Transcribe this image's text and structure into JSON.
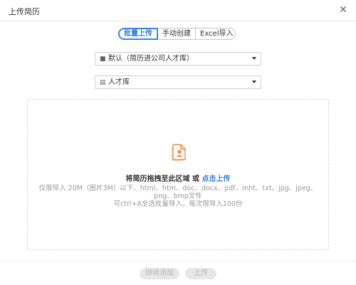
{
  "window": {
    "title": "上传简历",
    "close_glyph": "✕"
  },
  "tabs": [
    {
      "label": "批量上传",
      "active": true
    },
    {
      "label": "手动创建",
      "active": false
    },
    {
      "label": "Excel导入",
      "active": false
    }
  ],
  "selects": {
    "folder": {
      "icon": "folder-icon",
      "value": "默认（简历进公司人才库）"
    },
    "library": {
      "icon": "database-icon",
      "value": "人才库"
    }
  },
  "dropzone": {
    "main_text": "将简历拖拽至此区域 或 ",
    "link_text": "点击上传",
    "hint_line1": "仅限导入 20M（图片3M）以下、html、htm、doc、docx、pdf、mht、txt、jpg、jpeg、png、bmp文件",
    "hint_line2": "可ctrl+A全选批量导入，每次限导入100份"
  },
  "footer": {
    "continue_label": "继续添加",
    "upload_label": "上传"
  },
  "colors": {
    "accent": "#2f7ee2",
    "icon_orange": "#f08a3c"
  }
}
